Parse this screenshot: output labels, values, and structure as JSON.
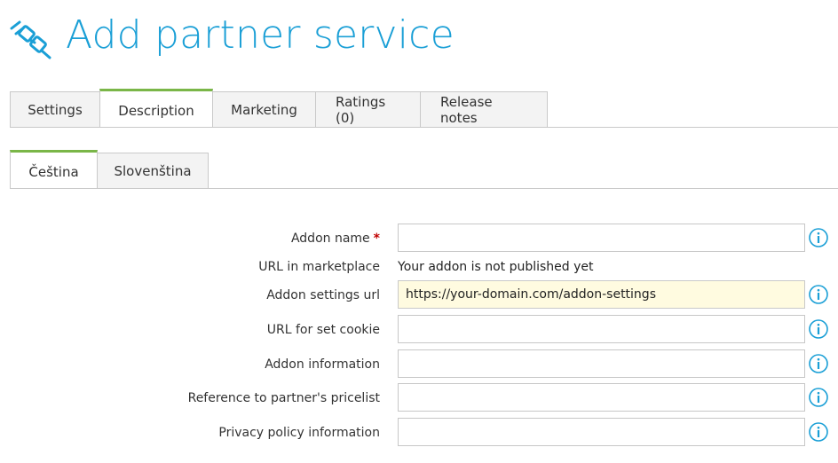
{
  "page": {
    "title": "Add partner service",
    "accent_color": "#1a9fd6",
    "tab_active_color": "#7ab648"
  },
  "primary_tabs": [
    {
      "label": "Settings",
      "active": false
    },
    {
      "label": "Description",
      "active": true
    },
    {
      "label": "Marketing",
      "active": false
    },
    {
      "label": "Ratings (0)",
      "active": false
    },
    {
      "label": "Release notes",
      "active": false
    }
  ],
  "language_tabs": [
    {
      "label": "Čeština",
      "active": true
    },
    {
      "label": "Slovenština",
      "active": false
    }
  ],
  "form": {
    "required_marker": "*",
    "addon_name": {
      "label": "Addon name",
      "value": "",
      "required": true,
      "info_icon": "info-icon"
    },
    "marketplace_url": {
      "label": "URL in marketplace",
      "value": "Your addon is not published yet"
    },
    "addon_settings_url": {
      "label": "Addon settings url",
      "value": "https://your-domain.com/addon-settings",
      "info_icon": "info-icon"
    },
    "set_cookie_url": {
      "label": "URL for set cookie",
      "value": "",
      "info_icon": "info-icon"
    },
    "addon_information": {
      "label": "Addon information",
      "value": "",
      "info_icon": "info-icon"
    },
    "pricelist_reference": {
      "label": "Reference to partner's pricelist",
      "value": "",
      "info_icon": "info-icon"
    },
    "privacy_policy": {
      "label": "Privacy policy information",
      "value": "",
      "info_icon": "info-icon"
    }
  }
}
